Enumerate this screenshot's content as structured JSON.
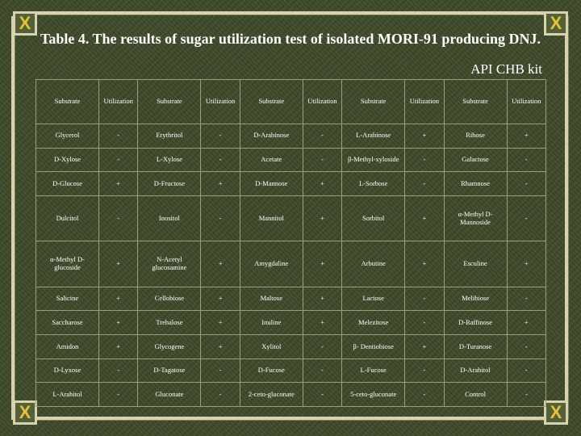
{
  "title": "Table 4. The results of sugar utilization test of isolated MORI-91 producing DNJ.",
  "kit_label": "API CHB kit",
  "corner_glyph": "X",
  "colors": {
    "background": "#3e4a2a",
    "frame": "#d8d3ad",
    "corner_glyph": "#e5c233",
    "text": "#ffffff"
  },
  "table": {
    "headers": [
      "Substrate",
      "Utilization",
      "Substrate",
      "Utilization",
      "Substrate",
      "Utilization",
      "Substrate",
      "Utilization",
      "Substrate",
      "Utilization"
    ],
    "rows": [
      [
        "Glycerol",
        "-",
        "Erythritol",
        "-",
        "D-Arabinose",
        "-",
        "L-Arabinose",
        "+",
        "Ribose",
        "+"
      ],
      [
        "D-Xylose",
        "-",
        "L-Xylose",
        "-",
        "Acetate",
        "-",
        "β-Methyl-xyloside",
        "-",
        "Galactose",
        "-"
      ],
      [
        "D-Glucose",
        "+",
        "D-Fructose",
        "+",
        "D-Mannose",
        "+",
        "L-Sorbose",
        "-",
        "Rhamnose",
        "-"
      ],
      [
        "Dulcitol",
        "-",
        "Inositol",
        "-",
        "Mannitol",
        "+",
        "Sorbitol",
        "+",
        "α-Methyl D-Mannoside",
        "-"
      ],
      [
        "α-Methyl D-glucoside",
        "+",
        "N-Acetyl glucosamine",
        "+",
        "Amygdaline",
        "+",
        "Arbutine",
        "+",
        "Esculine",
        "+"
      ],
      [
        "Salicine",
        "+",
        "Cellobiose",
        "+",
        "Maltose",
        "+",
        "Lactose",
        "-",
        "Melibiose",
        "-"
      ],
      [
        "Saccharose",
        "+",
        "Trehalose",
        "+",
        "Inuline",
        "+",
        "Melezitose",
        "-",
        "D-Raffinose",
        "+"
      ],
      [
        "Amidon",
        "+",
        "Glycogene",
        "+",
        "Xylitol",
        "-",
        "β- Dentiobiose",
        "+",
        "D-Turanose",
        "-"
      ],
      [
        "D-Lyxose",
        "-",
        "D-Tagatose",
        "-",
        "D-Fucose",
        "-",
        "L-Fucose",
        "-",
        "D-Arabitol",
        "-"
      ],
      [
        "L-Arabitol",
        "-",
        "Gluconate",
        "-",
        "2-ceto-gluconate",
        "-",
        "5-ceto-gluconate",
        "-",
        "Control",
        "-"
      ]
    ]
  }
}
